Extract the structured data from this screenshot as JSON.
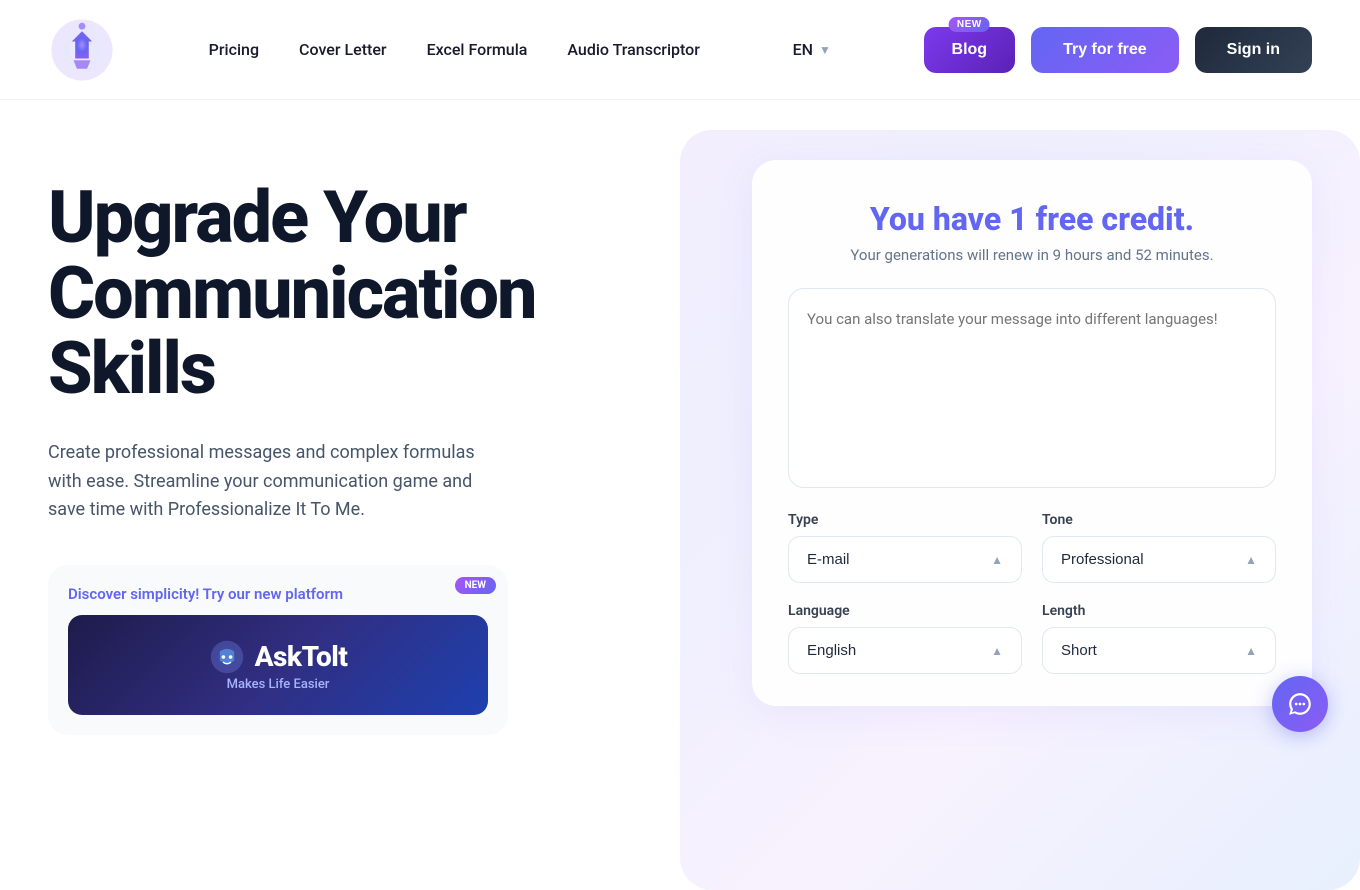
{
  "nav": {
    "logo_alt": "Professionalize It To Me Logo",
    "links": [
      {
        "label": "Pricing",
        "href": "#"
      },
      {
        "label": "Cover Letter",
        "href": "#"
      },
      {
        "label": "Excel Formula",
        "href": "#"
      },
      {
        "label": "Audio Transcriptor",
        "href": "#"
      }
    ],
    "lang": "EN",
    "blog_label": "Blog",
    "new_label": "New",
    "try_label": "Try for free",
    "signin_label": "Sign in"
  },
  "hero": {
    "title_line1": "Upgrade Your",
    "title_line2": "Communication",
    "title_line3": "Skills",
    "subtitle": "Create professional messages and complex formulas with ease. Streamline your communication game and save time with Professionalize It To Me.",
    "discover_label": "Discover simplicity! Try our new platform",
    "discover_new_label": "New",
    "asktolt_name": "AskTolt",
    "asktolt_tagline": "Makes Life Easier"
  },
  "form": {
    "title_prefix": "You have",
    "title_highlight": "1 free credit.",
    "subtitle": "Your generations will renew in 9 hours and 52 minutes.",
    "textarea_placeholder": "You can also translate your message into different languages!",
    "type_label": "Type",
    "type_value": "E-mail",
    "tone_label": "Tone",
    "tone_value": "Professional",
    "language_label": "Language",
    "language_value": "English",
    "length_label": "Length",
    "length_value": "Short"
  }
}
